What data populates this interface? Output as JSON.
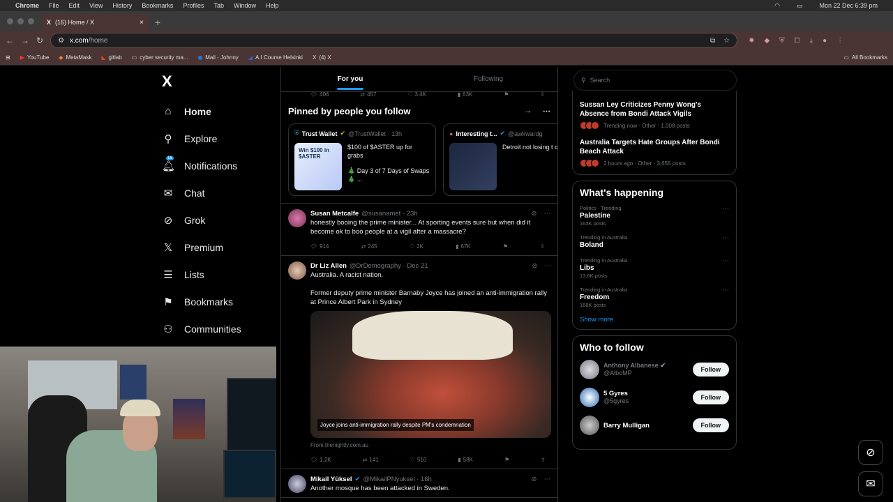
{
  "macbar": {
    "apple": "",
    "app": "Chrome",
    "menus": [
      "File",
      "Edit",
      "View",
      "History",
      "Bookmarks",
      "Profiles",
      "Tab",
      "Window",
      "Help"
    ],
    "datetime": "Mon 22 Dec 6:39 pm"
  },
  "browser": {
    "tab_title": "(16) Home / X",
    "url_host": "x.com",
    "url_path": "/home",
    "bookmarks": [
      "YouTube",
      "MetaMask",
      "gitlab",
      "cyber security ma...",
      "Mail - Johnny",
      "A.I Course Helsinki",
      "(4) X"
    ],
    "all_bookmarks": "All Bookmarks"
  },
  "sidebar": {
    "logo": "X",
    "items": [
      {
        "label": "Home",
        "icon": "home-icon",
        "glyph": "⌂"
      },
      {
        "label": "Explore",
        "icon": "search-icon",
        "glyph": "⚲"
      },
      {
        "label": "Notifications",
        "icon": "bell-icon",
        "glyph": "🔔︎",
        "badge": "16"
      },
      {
        "label": "Chat",
        "icon": "mail-icon",
        "glyph": "✉"
      },
      {
        "label": "Grok",
        "icon": "grok-icon",
        "glyph": "⊘"
      },
      {
        "label": "Premium",
        "icon": "x-icon",
        "glyph": "𝕏"
      },
      {
        "label": "Lists",
        "icon": "list-icon",
        "glyph": "☰"
      },
      {
        "label": "Bookmarks",
        "icon": "bookmark-icon",
        "glyph": "⚑"
      },
      {
        "label": "Communities",
        "icon": "people-icon",
        "glyph": "⚇"
      }
    ]
  },
  "feed": {
    "tabs": [
      "For you",
      "Following"
    ],
    "top_actions": {
      "replies": "406",
      "reposts": "457",
      "likes": "3.4K",
      "views": "63K"
    },
    "pinned": {
      "title": "Pinned by people you follow",
      "cards": [
        {
          "name": "Trust Wallet",
          "handle": "@TrustWallet · 13h",
          "thumb": "Win $100 in $ASTER",
          "text1": "$100 of $ASTER up for grabs",
          "text2": "🎄 Day 3 of 7 Days of Swaps 🎄 ..."
        },
        {
          "name": "Interesting t...",
          "handle": "@awkwardg",
          "thumb": "",
          "text1": "Detroit not losing t one.",
          "text2": ""
        }
      ]
    },
    "tweets": [
      {
        "name": "Susan Metcalfe",
        "handle": "@susanamet · 23h",
        "text": "honestly booing the prime minister... At sporting events sure but when did it become ok to boo people at a vigil after a massacre?",
        "replies": "914",
        "reposts": "245",
        "likes": "2K",
        "views": "67K"
      },
      {
        "name": "Dr Liz Allen",
        "handle": "@DrDemography · Dec 21",
        "text": "Australia. A racist nation.",
        "text2": "Former deputy prime minister Barnaby Joyce has joined an anti-immigration rally at Prince Albert Park in Sydney",
        "caption": "Joyce joins anti-immigration rally despite PM's condemnation",
        "source": "From thenightly.com.au",
        "replies": "1.2K",
        "reposts": "141",
        "likes": "510",
        "views": "58K"
      },
      {
        "name": "Mikail Yüksel",
        "handle": "@MikailPNyuksel · 16h",
        "text": "Another mosque has been attacked in Sweden."
      }
    ]
  },
  "right": {
    "search_placeholder": "Search",
    "news": [
      {
        "title": "Sussan Ley Criticizes Penny Wong's Absence from Bondi Attack Vigils",
        "meta": "Trending now · Other · 1,008 posts"
      },
      {
        "title": "Australia Targets Hate Groups After Bondi Beach Attack",
        "meta": "2 hours ago · Other · 3,655 posts"
      }
    ],
    "happening_title": "What's happening",
    "trends": [
      {
        "cat": "Politics · Trending",
        "name": "Palestine",
        "posts": "163K posts"
      },
      {
        "cat": "Trending in Australia",
        "name": "Boland",
        "posts": ""
      },
      {
        "cat": "Trending in Australia",
        "name": "Libs",
        "posts": "13.6K posts"
      },
      {
        "cat": "Trending in Australia",
        "name": "Freedom",
        "posts": "168K posts"
      }
    ],
    "show_more": "Show more",
    "who_title": "Who to follow",
    "who": [
      {
        "name": "Anthony Albanese",
        "handle": "@AlboMP",
        "btn": "Follow"
      },
      {
        "name": "5 Gyres",
        "handle": "@5gyres",
        "btn": "Follow"
      },
      {
        "name": "Barry Mulligan",
        "handle": "",
        "btn": "Follow"
      }
    ]
  },
  "colors": {
    "accent": "#1d9bf0",
    "bg": "#000000",
    "border": "#2f3336",
    "chrome_tint": "#4a3434"
  }
}
